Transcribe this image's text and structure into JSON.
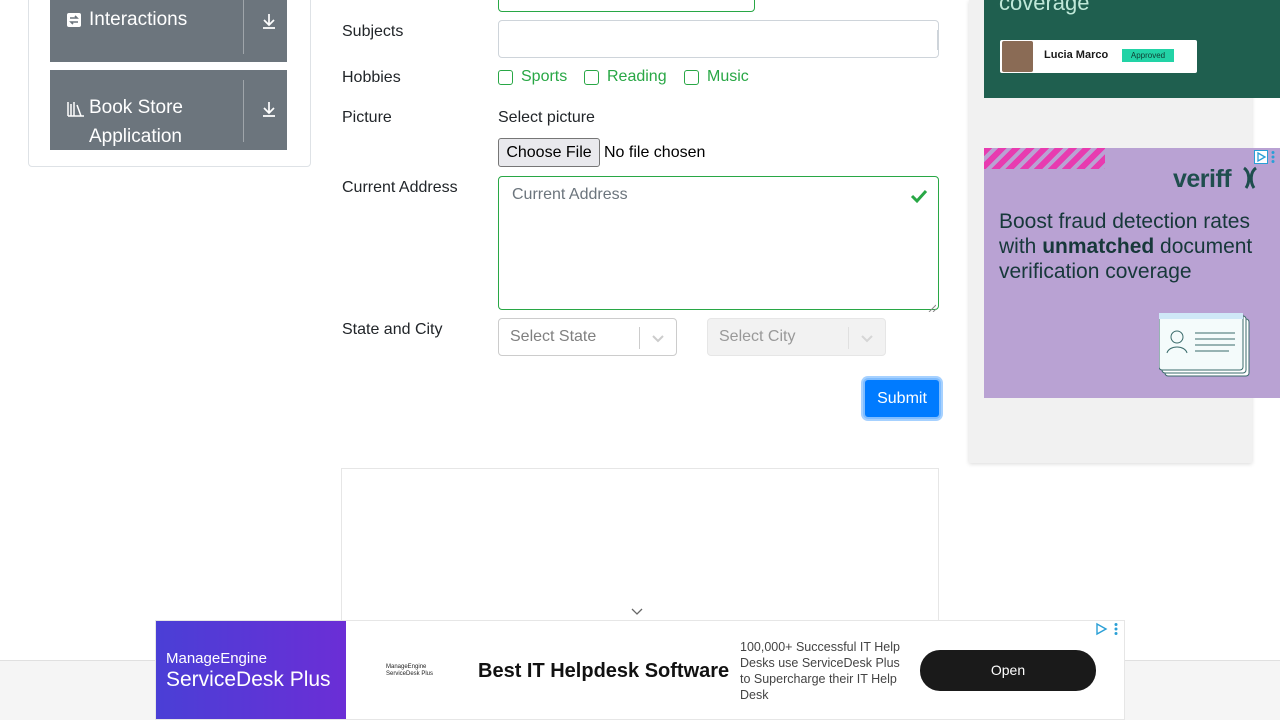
{
  "sidebar": {
    "groups": [
      {
        "label": "Interactions",
        "icon": "interactions-icon"
      },
      {
        "label": "Book Store Application",
        "icon": "book-store-icon"
      }
    ]
  },
  "form": {
    "subjects_label": "Subjects",
    "hobbies_label": "Hobbies",
    "hobbies": [
      "Sports",
      "Reading",
      "Music"
    ],
    "picture_label": "Picture",
    "picture_text": "Select picture",
    "file_button": "Choose File",
    "file_status": "No file chosen",
    "address_label": "Current Address",
    "address_placeholder": "Current Address",
    "state_city_label": "State and City",
    "state_placeholder": "Select State",
    "city_placeholder": "Select City",
    "submit": "Submit"
  },
  "ads": {
    "top": {
      "heading": "coverage",
      "name": "Lucia Marco",
      "badge": "Approved"
    },
    "veriff": {
      "brand": "veriff",
      "copy_prefix": "Boost fraud detection rates with ",
      "copy_bold": "unmatched",
      "copy_suffix": " document verification coverage"
    },
    "banner": {
      "brand_line1": "ManageEngine",
      "brand_line2": "ServiceDesk Plus",
      "mini_line1": "ManageEngine",
      "mini_line2": "ServiceDesk Plus",
      "headline": "Best IT Helpdesk Software",
      "description": "100,000+ Successful IT Help Desks use ServiceDesk Plus to Supercharge their IT Help Desk",
      "cta": "Open"
    }
  },
  "colors": {
    "success": "#28a745",
    "primary": "#007bff",
    "sidebar_header": "#6c757d"
  }
}
